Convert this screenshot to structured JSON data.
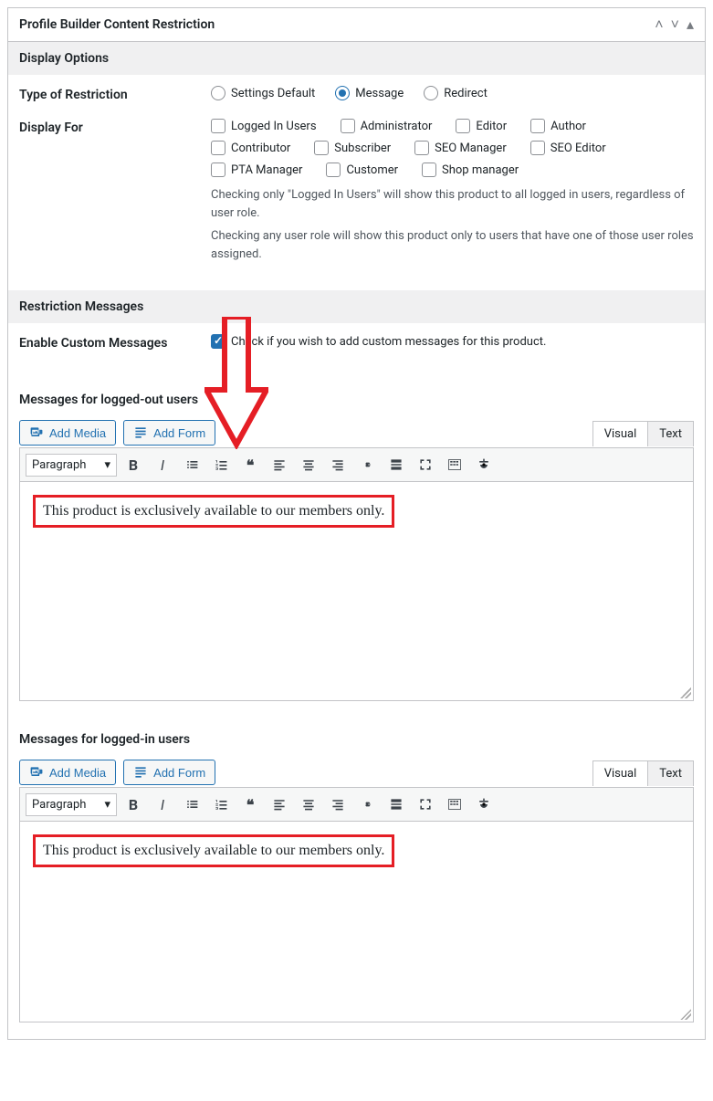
{
  "header": {
    "title": "Profile Builder Content Restriction"
  },
  "displayOptions": {
    "title": "Display Options",
    "typeOfRestriction": {
      "label": "Type of Restriction",
      "options": [
        {
          "label": "Settings Default",
          "value": "default",
          "checked": false
        },
        {
          "label": "Message",
          "value": "message",
          "checked": true
        },
        {
          "label": "Redirect",
          "value": "redirect",
          "checked": false
        }
      ]
    },
    "displayFor": {
      "label": "Display For",
      "options": [
        {
          "label": "Logged In Users",
          "checked": false
        },
        {
          "label": "Administrator",
          "checked": false
        },
        {
          "label": "Editor",
          "checked": false
        },
        {
          "label": "Author",
          "checked": false
        },
        {
          "label": "Contributor",
          "checked": false
        },
        {
          "label": "Subscriber",
          "checked": false
        },
        {
          "label": "SEO Manager",
          "checked": false
        },
        {
          "label": "SEO Editor",
          "checked": false
        },
        {
          "label": "PTA Manager",
          "checked": false
        },
        {
          "label": "Customer",
          "checked": false
        },
        {
          "label": "Shop manager",
          "checked": false
        }
      ],
      "help1": "Checking only \"Logged In Users\" will show this product to all logged in users, regardless of user role.",
      "help2": "Checking any user role will show this product only to users that have one of those user roles assigned."
    }
  },
  "restrictionMessages": {
    "title": "Restriction Messages",
    "enableCustom": {
      "label": "Enable Custom Messages",
      "checked": true,
      "desc": "Check if you wish to add custom messages for this product."
    },
    "editors": [
      {
        "label": "Messages for logged-out users",
        "addMedia": "Add Media",
        "addForm": "Add Form",
        "tabs": {
          "visual": "Visual",
          "text": "Text",
          "active": "visual"
        },
        "format": "Paragraph",
        "content": "This product is exclusively available to our members only."
      },
      {
        "label": "Messages for logged-in users",
        "addMedia": "Add Media",
        "addForm": "Add Form",
        "tabs": {
          "visual": "Visual",
          "text": "Text",
          "active": "visual"
        },
        "format": "Paragraph",
        "content": "This product is exclusively available to our members only."
      }
    ]
  }
}
